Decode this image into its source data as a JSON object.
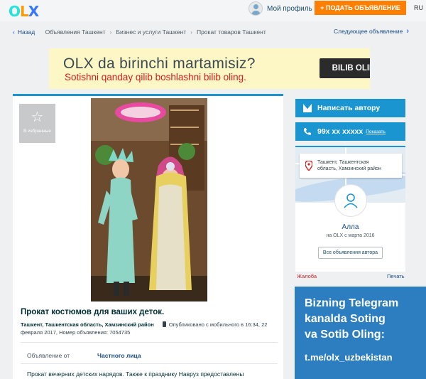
{
  "header": {
    "logo": {
      "o": "O",
      "l": "L",
      "x": "X"
    },
    "profile_label": "Мой профиль",
    "post_button": "+ ПОДАТЬ ОБЪЯВЛЕНИЕ",
    "language": "RU"
  },
  "breadcrumb": {
    "back": "Назад",
    "items": [
      "Объявления Ташкент",
      "Бизнес и услуги Ташкент",
      "Прокат товаров Ташкент"
    ],
    "next": "Следующее объявление"
  },
  "banner": {
    "title": "OLX da birinchi martamisiz?",
    "subtitle": "Sotishni qanday qilib boshlashni bilib oling.",
    "cta": "BILIB OLING"
  },
  "ad": {
    "favorite_label": "В избранные",
    "title": "Прокат костюмов для ваших деток.",
    "location": "Ташкент, Ташкентская область, Хамзинский район",
    "published": "Опубликовано с мобильного",
    "published_date": "в 16:34, 22 февраля 2017,",
    "ad_number": "Номер объявления: 7054735",
    "param_label": "Объявление от",
    "param_value": "Частного лица",
    "description": "Прокат вечерних детских нарядов. Также к празднику Навруз предоставлены"
  },
  "contact": {
    "message_button": "Написать автору",
    "phone": "99x xx xxxxx",
    "show_label": "Показать"
  },
  "seller": {
    "location": [
      "Ташкент, Ташкентская",
      "область, Хамзинский район"
    ],
    "name": "Алла",
    "since": "на OLX с марта 2016",
    "all_ads": "Все объявления автора"
  },
  "links": {
    "complaint": "Жалоба",
    "print": "Печать"
  },
  "telegram": {
    "line1": "Bizning Telegram",
    "line2": "kanalda Soting",
    "line3": "va Sotib Oling:",
    "link": "t.me/olx_uzbekistan"
  },
  "colors": {
    "accent_blue": "#1a95d0",
    "post_orange": "#ff7f00",
    "banner_bg": "#fdf6c5",
    "telegram_bg": "#2d7ec0"
  }
}
